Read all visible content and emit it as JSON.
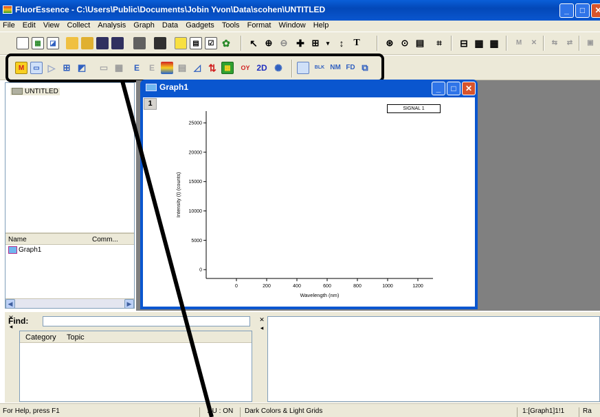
{
  "window": {
    "title": "FluorEssence - C:\\Users\\Public\\Documents\\Jobin Yvon\\Data\\scohen\\UNTITLED",
    "min": "_",
    "max": "□",
    "close": "✕"
  },
  "menu": [
    "File",
    "Edit",
    "View",
    "Collect",
    "Analysis",
    "Graph",
    "Data",
    "Gadgets",
    "Tools",
    "Format",
    "Window",
    "Help"
  ],
  "toolbar2_text": {
    "e1": "E",
    "e2": "E",
    "oy": "OY",
    "twod": "2D",
    "blk": "BLK",
    "nm": "NM",
    "fd": "FD"
  },
  "project": {
    "folder": "UNTITLED"
  },
  "list": {
    "col_name": "Name",
    "col_comm": "Comm...",
    "item": "Graph1"
  },
  "graph_window": {
    "title": "Graph1",
    "layer": "1",
    "legend": "SIGNAL 1"
  },
  "chart_data": {
    "type": "line",
    "title": "",
    "xlabel": "Wavelength (nm)",
    "ylabel": "Intensity (I) (counts)",
    "xlim": [
      -200,
      1300
    ],
    "ylim": [
      -1500,
      27000
    ],
    "xticks": [
      0,
      200,
      400,
      600,
      800,
      1000,
      1200
    ],
    "yticks": [
      0,
      5000,
      10000,
      15000,
      20000,
      25000
    ],
    "series": [
      {
        "name": "SIGNAL 1",
        "x": [],
        "y": []
      }
    ],
    "grid": false,
    "legend_position": "top-right"
  },
  "find": {
    "label": "Find:",
    "value": "",
    "col_category": "Category",
    "col_topic": "Topic"
  },
  "status": {
    "help": "For Help, press F1",
    "au": "AU : ON",
    "theme": "Dark Colors & Light Grids",
    "layer": "1:[Graph1]1!1",
    "ra": "Ra"
  }
}
